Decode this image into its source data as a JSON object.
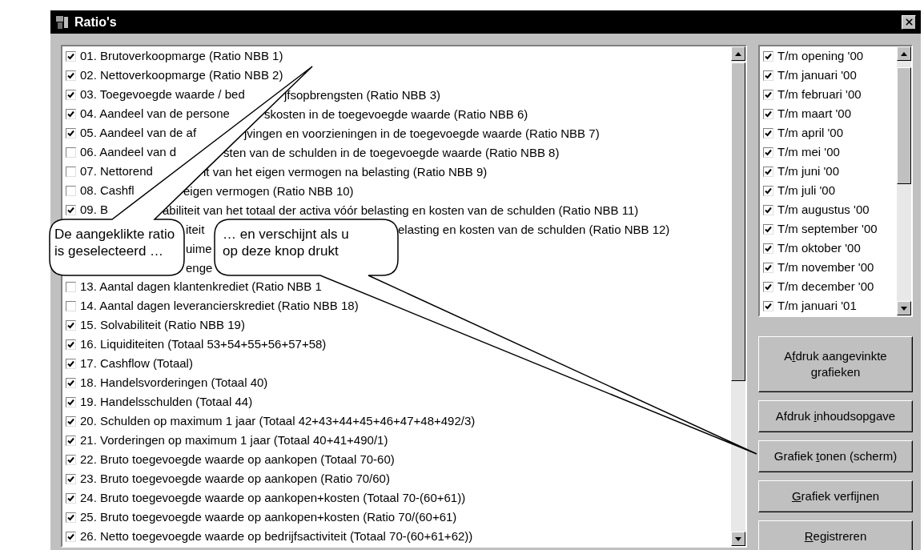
{
  "window": {
    "title": "Ratio's"
  },
  "ratios": [
    {
      "kind": "checkbox",
      "checked": true,
      "parts": [
        "01. Brutoverkoopmarge (Ratio NBB 1)"
      ]
    },
    {
      "kind": "checkbox",
      "checked": true,
      "parts": [
        "02. Nettoverkoopmarge (Ratio NBB 2)"
      ]
    },
    {
      "kind": "checkbox",
      "checked": true,
      "parts": [
        "03. Toegevoegde waarde / bed",
        "jfsopbrengsten (Ratio NBB 3)"
      ]
    },
    {
      "kind": "checkbox",
      "checked": true,
      "parts": [
        "04. Aandeel van de persone",
        "skosten in de toegevoegde waarde (Ratio NBB 6)"
      ]
    },
    {
      "kind": "checkbox",
      "checked": true,
      "parts": [
        "05. Aandeel van de af",
        "jvingen en voorzieningen in de toegevoegde waarde (Ratio NBB 7)"
      ]
    },
    {
      "kind": "checkbox",
      "checked": false,
      "parts": [
        "06. Aandeel van d",
        "sten van de schulden in de toegevoegde waarde (Ratio NBB 8)"
      ]
    },
    {
      "kind": "checkbox",
      "checked": false,
      "parts": [
        "07. Nettorend",
        "it van het eigen vermogen na belasting (Ratio NBB 9)"
      ]
    },
    {
      "kind": "checkbox",
      "checked": false,
      "parts": [
        "08. Cashfl",
        "eigen vermogen (Ratio NBB 10)"
      ]
    },
    {
      "kind": "checkbox",
      "checked": true,
      "parts": [
        "09. B",
        "abiliteit van het totaal der activa vóór belasting en kosten van de schulden (Ratio NBB 11)"
      ]
    },
    {
      "kind": "covered",
      "parts": [
        "iteit",
        "elasting en kosten van de schulden (Ratio NBB 12)"
      ]
    },
    {
      "kind": "covered",
      "parts": [
        "uime"
      ]
    },
    {
      "kind": "covered",
      "parts": [
        "enge"
      ]
    },
    {
      "kind": "checkbox",
      "checked": false,
      "parts": [
        "13. Aantal dagen klantenkrediet (Ratio NBB 1"
      ]
    },
    {
      "kind": "checkbox",
      "checked": false,
      "parts": [
        "14. Aantal dagen leverancierskrediet (Ratio NBB 18)"
      ]
    },
    {
      "kind": "checkbox",
      "checked": true,
      "parts": [
        "15. Solvabiliteit (Ratio NBB 19)"
      ]
    },
    {
      "kind": "checkbox",
      "checked": true,
      "parts": [
        "16. Liquiditeiten (Totaal 53+54+55+56+57+58)"
      ]
    },
    {
      "kind": "checkbox",
      "checked": true,
      "parts": [
        "17. Cashflow (Totaal)"
      ]
    },
    {
      "kind": "checkbox",
      "checked": true,
      "parts": [
        "18. Handelsvorderingen (Totaal 40)"
      ]
    },
    {
      "kind": "checkbox",
      "checked": true,
      "parts": [
        "19. Handelsschulden (Totaal 44)"
      ]
    },
    {
      "kind": "checkbox",
      "checked": true,
      "parts": [
        "20. Schulden op maximum 1 jaar (Totaal 42+43+44+45+46+47+48+492/3)"
      ]
    },
    {
      "kind": "checkbox",
      "checked": true,
      "parts": [
        "21. Vorderingen op maximum 1 jaar (Totaal 40+41+490/1)"
      ]
    },
    {
      "kind": "checkbox",
      "checked": true,
      "parts": [
        "22. Bruto toegevoegde waarde op aankopen (Totaal 70-60)"
      ]
    },
    {
      "kind": "checkbox",
      "checked": true,
      "parts": [
        "23. Bruto toegevoegde waarde op aankopen (Ratio 70/60)"
      ]
    },
    {
      "kind": "checkbox",
      "checked": true,
      "parts": [
        "24. Bruto toegevoegde waarde op aankopen+kosten (Totaal 70-(60+61))"
      ]
    },
    {
      "kind": "checkbox",
      "checked": true,
      "parts": [
        "25. Bruto toegevoegde waarde op aankopen+kosten (Ratio 70/(60+61)"
      ]
    },
    {
      "kind": "checkbox",
      "checked": true,
      "parts": [
        "26. Netto toegevoegde waarde op bedrijfsactiviteit (Totaal 70-(60+61+62))"
      ]
    }
  ],
  "periods": [
    {
      "label": "T/m opening '00",
      "checked": true
    },
    {
      "label": "T/m januari '00",
      "checked": true
    },
    {
      "label": "T/m februari '00",
      "checked": true
    },
    {
      "label": "T/m maart '00",
      "checked": true
    },
    {
      "label": "T/m april '00",
      "checked": true
    },
    {
      "label": "T/m mei '00",
      "checked": true
    },
    {
      "label": "T/m juni '00",
      "checked": true
    },
    {
      "label": "T/m juli '00",
      "checked": true
    },
    {
      "label": "T/m augustus '00",
      "checked": true
    },
    {
      "label": "T/m september '00",
      "checked": true
    },
    {
      "label": "T/m oktober '00",
      "checked": true
    },
    {
      "label": "T/m november '00",
      "checked": true
    },
    {
      "label": "T/m december '00",
      "checked": true
    },
    {
      "label": "T/m januari '01",
      "checked": true
    }
  ],
  "buttons": [
    {
      "pre": "A",
      "key": "f",
      "post": "druk aangevinkte grafieken"
    },
    {
      "pre": "Afdruk ",
      "key": "i",
      "post": "nhoudsopgave"
    },
    {
      "pre": "Grafiek ",
      "key": "t",
      "post": "onen (scherm)"
    },
    {
      "key": "G",
      "post": "rafiek verfijnen"
    },
    {
      "key": "R",
      "post": "egistreren"
    }
  ],
  "callouts": [
    {
      "text": "De aangeklikte ratio is geselecteerd …"
    },
    {
      "text": "… en verschijnt als u op deze knop drukt"
    }
  ]
}
